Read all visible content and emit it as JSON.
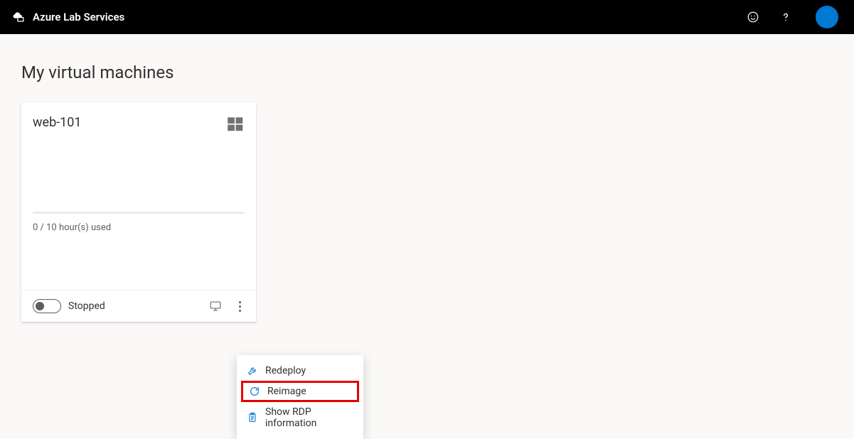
{
  "header": {
    "product_name": "Azure Lab Services"
  },
  "page": {
    "title": "My virtual machines"
  },
  "vm": {
    "name": "web-101",
    "os_icon": "windows-icon",
    "quota_text": "0 / 10 hour(s) used",
    "status": "Stopped"
  },
  "menu": {
    "redeploy": "Redeploy",
    "reimage": "Reimage",
    "show_rdp": "Show RDP information"
  },
  "colors": {
    "azure_blue": "#0078d4",
    "highlight_red": "#e60000"
  }
}
